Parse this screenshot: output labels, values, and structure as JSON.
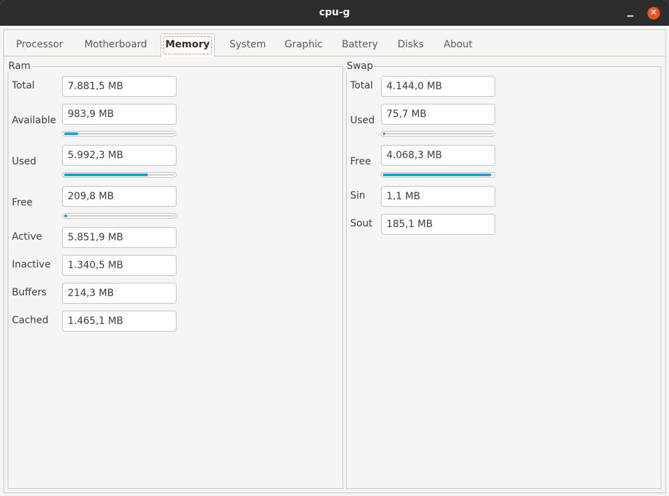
{
  "window": {
    "title": "cpu-g"
  },
  "tabs": [
    "Processor",
    "Motherboard",
    "Memory",
    "System",
    "Graphic",
    "Battery",
    "Disks",
    "About"
  ],
  "active_tab": "Memory",
  "ram": {
    "label": "Ram",
    "total": {
      "label": "Total",
      "value": "7.881,5 MB"
    },
    "available": {
      "label": "Available",
      "value": "983,9 MB",
      "fraction": 0.125
    },
    "used": {
      "label": "Used",
      "value": "5.992,3 MB",
      "fraction": 0.76
    },
    "free": {
      "label": "Free",
      "value": "209,8 MB",
      "fraction": 0.027
    },
    "active": {
      "label": "Active",
      "value": "5.851,9 MB"
    },
    "inactive": {
      "label": "Inactive",
      "value": "1.340,5 MB"
    },
    "buffers": {
      "label": "Buffers",
      "value": "214,3 MB"
    },
    "cached": {
      "label": "Cached",
      "value": "1.465,1 MB"
    }
  },
  "swap": {
    "label": "Swap",
    "total": {
      "label": "Total",
      "value": "4.144,0 MB"
    },
    "used": {
      "label": "Used",
      "value": "75,7 MB",
      "fraction": 0.018
    },
    "free": {
      "label": "Free",
      "value": "4.068,3 MB",
      "fraction": 0.982
    },
    "sin": {
      "label": "Sin",
      "value": "1,1 MB"
    },
    "sout": {
      "label": "Sout",
      "value": "185,1 MB"
    }
  },
  "colors": {
    "accent": "#19a3d8",
    "close_button": "#e95420",
    "titlebar": "#2c2c2c"
  }
}
